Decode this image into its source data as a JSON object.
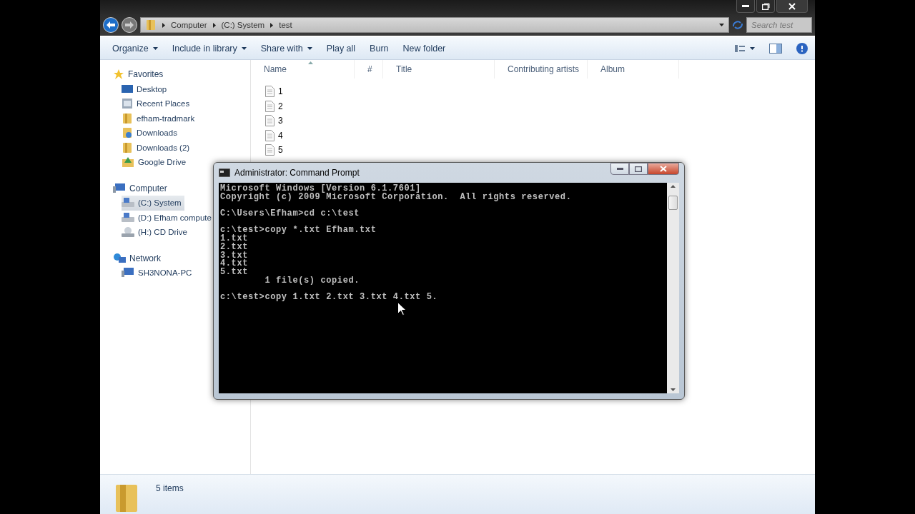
{
  "explorer": {
    "breadcrumb": [
      "Computer",
      "(C:) System",
      "test"
    ],
    "search": {
      "placeholder": "Search test"
    },
    "toolbar": [
      {
        "label": "Organize",
        "dropdown": true
      },
      {
        "label": "Include in library",
        "dropdown": true
      },
      {
        "label": "Share with",
        "dropdown": true
      },
      {
        "label": "Play all",
        "dropdown": false
      },
      {
        "label": "Burn",
        "dropdown": false
      },
      {
        "label": "New folder",
        "dropdown": false
      }
    ],
    "sidebar": [
      {
        "label": "Favorites",
        "kind": "star",
        "selected": false,
        "children": [
          {
            "label": "Desktop",
            "kind": "desktop",
            "selected": false
          },
          {
            "label": "Recent Places",
            "kind": "recent",
            "selected": false
          },
          {
            "label": "efham-tradmark",
            "kind": "folder",
            "selected": false
          },
          {
            "label": "Downloads",
            "kind": "download",
            "selected": false
          },
          {
            "label": "Downloads (2)",
            "kind": "folder",
            "selected": false
          },
          {
            "label": "Google Drive",
            "kind": "drive",
            "selected": false
          }
        ]
      },
      {
        "label": "Computer",
        "kind": "computer",
        "selected": false,
        "children": [
          {
            "label": "(C:) System",
            "kind": "disk",
            "selected": true
          },
          {
            "label": "(D:) Efham compute",
            "kind": "disk",
            "selected": false
          },
          {
            "label": "(H:) CD Drive",
            "kind": "cd",
            "selected": false
          }
        ]
      },
      {
        "label": "Network",
        "kind": "network",
        "selected": false,
        "children": [
          {
            "label": "SH3NONA-PC",
            "kind": "computer",
            "selected": false
          }
        ]
      }
    ],
    "columns": [
      "Name",
      "#",
      "Title",
      "Contributing artists",
      "Album"
    ],
    "files": [
      "1",
      "2",
      "3",
      "4",
      "5"
    ],
    "status": "5 items"
  },
  "console": {
    "title": "Administrator: Command Prompt",
    "blocks": [
      [
        "Microsoft Windows [Version 6.1.7601]",
        "Copyright (c) 2009 Microsoft Corporation.  All rights reserved."
      ],
      [
        "C:\\Users\\Efham>cd c:\\test"
      ],
      [
        "c:\\test>copy *.txt Efham.txt",
        "1.txt",
        "2.txt",
        "3.txt",
        "4.txt",
        "5.txt",
        "        1 file(s) copied."
      ],
      [
        "c:\\test>copy 1.txt 2.txt 3.txt 4.txt 5."
      ]
    ]
  }
}
